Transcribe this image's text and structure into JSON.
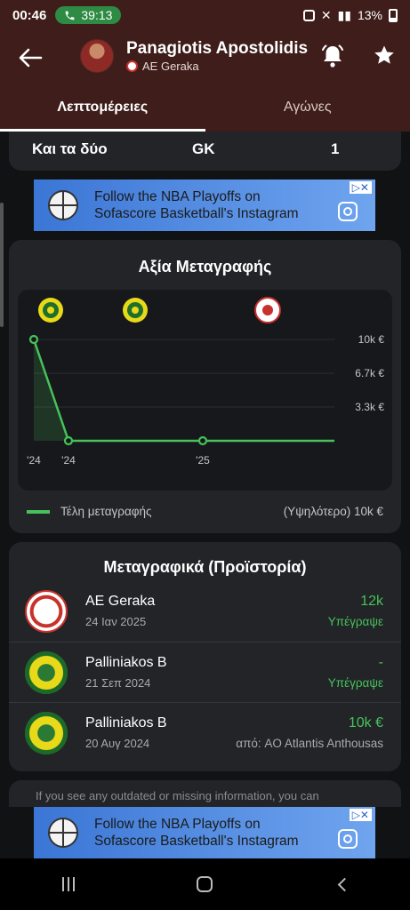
{
  "status_bar": {
    "time": "00:46",
    "call_time": "39:13",
    "battery": "13%"
  },
  "header": {
    "player_name": "Panagiotis Apostolidis",
    "team": "AE Geraka",
    "tabs": [
      {
        "label": "Λεπτομέρειες",
        "active": true
      },
      {
        "label": "Αγώνες",
        "active": false
      }
    ]
  },
  "info_card": {
    "values": [
      "Και τα δύο",
      "GK",
      "1"
    ]
  },
  "ad": {
    "line1": "Follow the NBA Playoffs on",
    "line2": "Sofascore Basketball's Instagram",
    "close": "▷✕"
  },
  "transfer_value": {
    "title": "Αξία Μεταγραφής",
    "legend_label": "Τέλη μεταγραφής",
    "legend_max": "(Υψηλότερο) 10k €"
  },
  "chart_data": {
    "type": "line",
    "x": [
      "'24",
      "'24",
      "'25",
      ""
    ],
    "x_labels": [
      "'24",
      "'24",
      "'25"
    ],
    "values": [
      10000,
      0,
      0,
      0
    ],
    "y_ticks": [
      "10k €",
      "6.7k €",
      "3.3k €"
    ],
    "ylim": [
      0,
      10000
    ],
    "series": [
      {
        "name": "Τέλη μεταγραφής",
        "color": "#46c25a"
      }
    ],
    "grid": true
  },
  "history": {
    "title": "Μεταγραφικά (Προϊστορία)",
    "rows": [
      {
        "club": "AE Geraka",
        "date": "24 Ιαν 2025",
        "fee": "12k",
        "sub": "Υπέγραψε"
      },
      {
        "club": "Palliniakos B",
        "date": "21 Σεπ 2024",
        "fee": "-",
        "sub": "Υπέγραψε"
      },
      {
        "club": "Palliniakos B",
        "date": "20 Αυγ 2024",
        "fee": "10k €",
        "sub": "από: AO Atlantis Anthousas"
      }
    ]
  },
  "footer": {
    "text": "If you see any outdated or missing information, you can"
  },
  "colors": {
    "accent": "#46c25a",
    "header_bg": "#3e1d1a",
    "card_bg": "#222428"
  },
  "icons": [
    "back-arrow-icon",
    "bell-icon",
    "star-icon",
    "phone-icon"
  ]
}
